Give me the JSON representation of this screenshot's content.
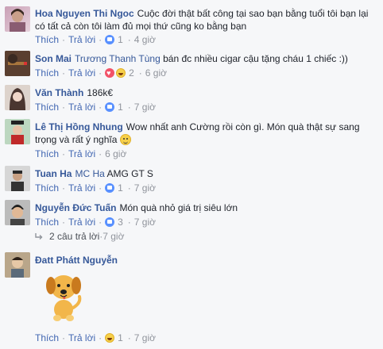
{
  "comments": [
    {
      "author": "Hoa Nguyen Thi Ngoc",
      "mention": "",
      "text": "Cuộc đời thật bất công tại sao bạn bằng tuổi tôi bạn lại có tất cả còn tôi làm đủ mọi thứ cũng ko bằng bạn",
      "like_label": "Thích",
      "reply_label": "Trả lời",
      "reaction_count": "1",
      "time": "4 giờ",
      "reactions": [
        "like"
      ]
    },
    {
      "author": "Son Mai",
      "mention": "Trương Thanh Tùng",
      "text": "bán đc nhiều cigar cậu tặng cháu 1 chiếc :))",
      "like_label": "Thích",
      "reply_label": "Trả lời",
      "reaction_count": "2",
      "time": "6 giờ",
      "reactions": [
        "love",
        "haha"
      ]
    },
    {
      "author": "Văn Thành",
      "mention": "",
      "text": "186k€",
      "like_label": "Thích",
      "reply_label": "Trả lời",
      "reaction_count": "1",
      "time": "7 giờ",
      "reactions": [
        "like"
      ]
    },
    {
      "author": "Lê Thị Hồng Nhung",
      "mention": "",
      "text": "Wow nhất anh Cường rồi còn gì. Món quà thật sự sang trọng và rất ý nghĩa",
      "like_label": "Thích",
      "reply_label": "Trả lời",
      "reaction_count": "",
      "time": "6 giờ",
      "reactions": []
    },
    {
      "author": "Tuan Ha",
      "mention": "MC Ha",
      "text": "AMG GT S",
      "like_label": "Thích",
      "reply_label": "Trả lời",
      "reaction_count": "1",
      "time": "7 giờ",
      "reactions": [
        "like"
      ]
    },
    {
      "author": "Nguyễn Đức Tuấn",
      "mention": "",
      "text": "Món quà nhỏ giá trị siêu lớn",
      "like_label": "Thích",
      "reply_label": "Trả lời",
      "reaction_count": "3",
      "time": "7 giờ",
      "reactions": [
        "like"
      ]
    },
    {
      "author": "Đatt Phátt Nguyễn",
      "mention": "",
      "text": "",
      "like_label": "Thích",
      "reply_label": "Trả lời",
      "reaction_count": "1",
      "time": "7 giờ",
      "reactions": [
        "haha"
      ]
    }
  ],
  "replies_link": {
    "label": "2 câu trả lời",
    "time": "7 giờ"
  },
  "icons": {
    "like": "like-reaction-icon",
    "love": "love-reaction-icon",
    "haha": "haha-reaction-icon",
    "reply_arrow": "reply-arrow-icon",
    "sticker": "dog-sticker-icon"
  },
  "colors": {
    "author": "#365899",
    "link": "#4267b2",
    "meta": "#90949c",
    "background": "#f6f7f9"
  }
}
